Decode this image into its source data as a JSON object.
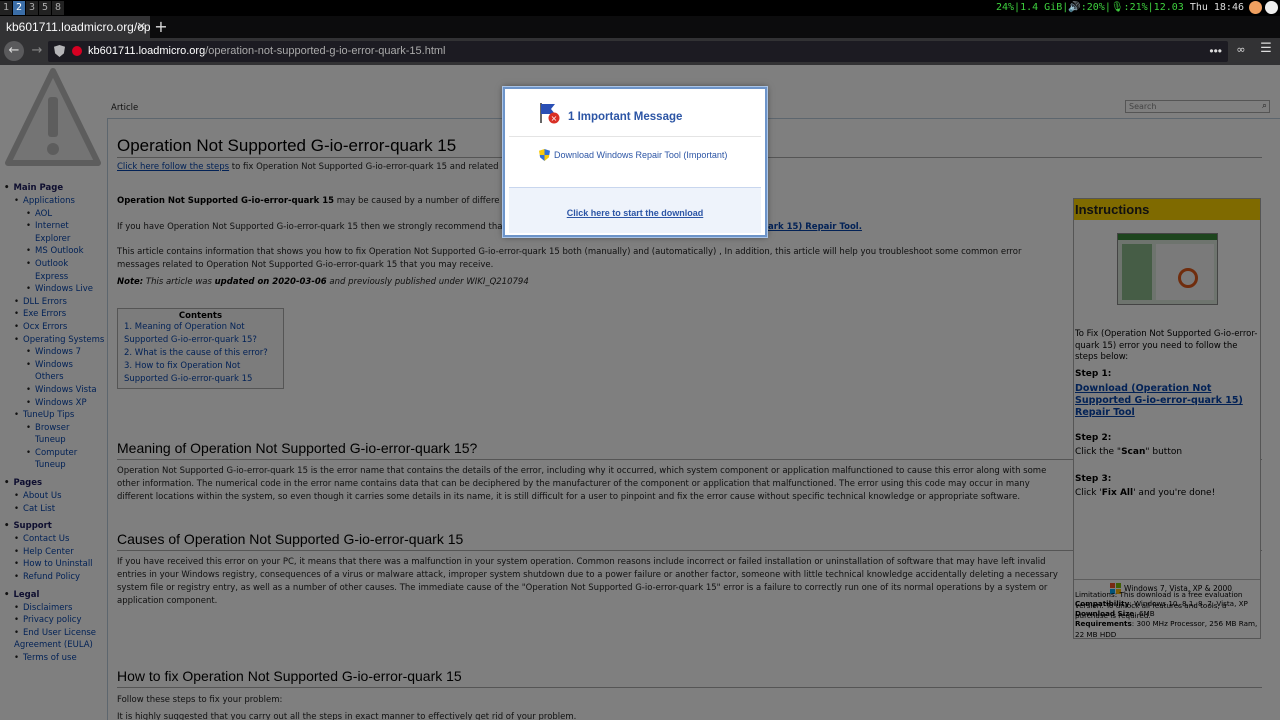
{
  "system_bar": {
    "workspaces": [
      "1",
      "2",
      "3",
      "5",
      "8"
    ],
    "active_workspace": "2",
    "cpu": "24%",
    "memory": "1.4 GiB",
    "volume": "20%",
    "mic": "21%",
    "load": "12.03",
    "datetime": "Thu 18:46"
  },
  "browser": {
    "tab_title": "kb601711.loadmicro.org/ope",
    "url_host": "kb601711.loadmicro.org",
    "url_path": "/operation-not-supported-g-io-error-quark-15.html",
    "url_menu": "•••"
  },
  "page": {
    "tab_article": "Article",
    "search_placeholder": "Search",
    "title": "Operation Not Supported G-io-error-quark 15",
    "intro_link": "Click here follow the steps",
    "intro_rest": " to fix Operation Not Supported G-io-error-quark 15 and related",
    "p1_bold": "Operation Not Supported G-io-error-quark 15",
    "p1_rest": " may be caused by a number of differe",
    "p2_start": "If you have Operation Not Supported G-io-error-quark 15 then we strongly recommend tha",
    "p2_link": "uark 15) Repair Tool.",
    "p3": "This article contains information that shows you how to fix Operation Not Supported G-io-error-quark 15 both (manually) and (automatically) , In addition, this article will help you troubleshoot some common error messages related to Operation Not Supported G-io-error-quark 15 that you may receive.",
    "note_label": "Note:",
    "note_mid": " This article was ",
    "note_bold": "updated on 2020-03-06",
    "note_end": " and previously published under WIKI_Q210794",
    "toc": {
      "title": "Contents",
      "items": [
        "1. Meaning of Operation Not Supported G-io-error-quark 15?",
        "2. What is the cause of this error?",
        "3. How to fix Operation Not Supported G-io-error-quark 15"
      ]
    },
    "h2_meaning": "Meaning of Operation Not Supported G-io-error-quark 15?",
    "meaning_text": "Operation Not Supported G-io-error-quark 15 is the error name that contains the details of the error, including why it occurred, which system component or application malfunctioned to cause this error along with some other information. The numerical code in the error name contains data that can be deciphered by the manufacturer of the component or application that malfunctioned. The error using this code may occur in many different locations within the system, so even though it carries some details in its name, it is still difficult for a user to pinpoint and fix the error cause without specific technical knowledge or appropriate software.",
    "h2_causes": "Causes of Operation Not Supported G-io-error-quark 15",
    "causes_text": "If you have received this error on your PC, it means that there was a malfunction in your system operation. Common reasons include incorrect or failed installation or uninstallation of software that may have left invalid entries in your Windows registry, consequences of a virus or malware attack, improper system shutdown due to a power failure or another factor, someone with little technical knowledge accidentally deleting a necessary system file or registry entry, as well as a number of other causes. The immediate cause of the \"Operation Not Supported G-io-error-quark 15\" error is a failure to correctly run one of its normal operations by a system or application component.",
    "h2_howto": "How to fix Operation Not Supported G-io-error-quark 15",
    "howto_text1": "Follow these steps to fix your problem:",
    "howto_text2": "It is highly suggested that you carry out all the steps in exact manner to effectively get rid of your problem."
  },
  "sidebar": {
    "groups": [
      {
        "head": "Main Page",
        "items": [
          {
            "label": "Applications",
            "subs": [
              "AOL",
              "Internet Explorer",
              "MS Outlook",
              "Outlook Express",
              "Windows Live"
            ]
          },
          {
            "label": "DLL Errors",
            "subs": []
          },
          {
            "label": "Exe Errors",
            "subs": []
          },
          {
            "label": "Ocx Errors",
            "subs": []
          },
          {
            "label": "Operating Systems",
            "subs": [
              "Windows 7",
              "Windows Others",
              "Windows Vista",
              "Windows XP"
            ]
          },
          {
            "label": "TuneUp Tips",
            "subs": [
              "Browser Tuneup",
              "Computer Tuneup"
            ]
          }
        ]
      },
      {
        "head": "Pages",
        "items": [
          {
            "label": "About Us",
            "subs": []
          },
          {
            "label": "Cat List",
            "subs": []
          }
        ]
      },
      {
        "head": "Support",
        "items": [
          {
            "label": "Contact Us",
            "subs": []
          },
          {
            "label": "Help Center",
            "subs": []
          },
          {
            "label": "How to Uninstall",
            "subs": []
          },
          {
            "label": "Refund Policy",
            "subs": []
          }
        ]
      },
      {
        "head": "Legal",
        "items": [
          {
            "label": "Disclaimers",
            "subs": []
          },
          {
            "label": "Privacy policy",
            "subs": []
          },
          {
            "label": "End User License Agreement (EULA)",
            "subs": []
          },
          {
            "label": "Terms of use",
            "subs": []
          }
        ]
      }
    ]
  },
  "instructions": {
    "title": "Instructions",
    "lead": "To Fix (Operation Not Supported G-io-error-quark 15) error you need to follow the steps below:",
    "step1_head": "Step 1:",
    "step1_link": "Download (Operation Not Supported G-io-error-quark 15) Repair Tool",
    "step2_head": "Step 2:",
    "step2_pre": "Click the \"",
    "step2_bold": "Scan",
    "step2_post": "\" button",
    "step3_head": "Step 3:",
    "step3_pre": "Click '",
    "step3_bold": "Fix All",
    "step3_post": "' and you're done!",
    "compat_os": "Windows 7, Vista, XP & 2000",
    "compat_label": "Compatibility",
    "compat_value": ": Windows 10, 8.1, 8, 7, Vista, XP",
    "size_label": "Download Size",
    "size_value": ": 6MB",
    "req_label": "Requirements",
    "req_value": ": 300 MHz Processor, 256 MB Ram, 22 MB HDD",
    "limitations": "Limitations: This download is a free evaluation version. To unlock all features and tools, a purchase is required."
  },
  "popup": {
    "title": "1 Important Message",
    "download_link": "Download Windows Repair Tool (Important)",
    "cta": "Click here to start the download"
  },
  "colors": {
    "instructions_header": "#ffd400",
    "link": "#0645ad",
    "popup_text": "#2c55a5",
    "status_green": "#3ed13e"
  }
}
